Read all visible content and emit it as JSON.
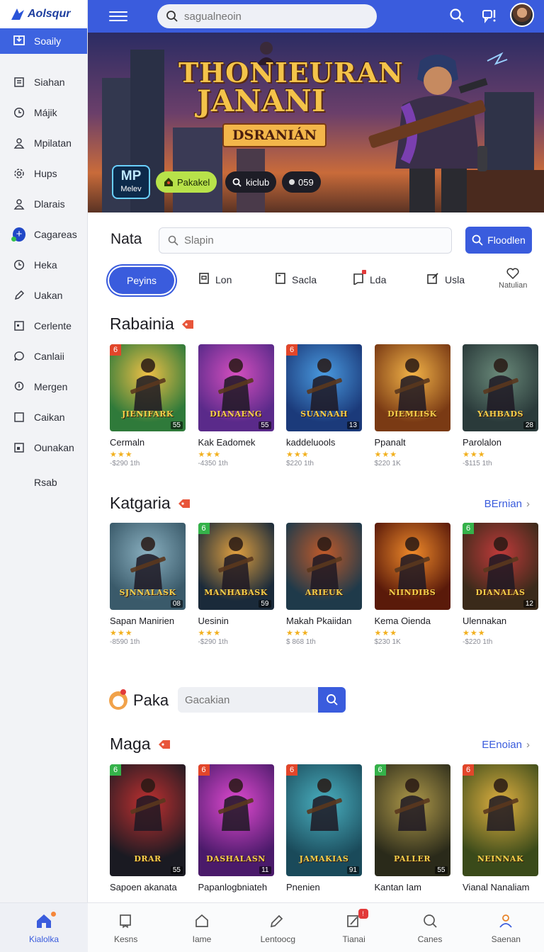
{
  "app": {
    "logo_text": "Aolsqur"
  },
  "sidebar": {
    "active": {
      "label": "Soaily"
    },
    "items": [
      {
        "label": "Siahan",
        "icon": "document-icon"
      },
      {
        "label": "Májik",
        "icon": "clock-icon"
      },
      {
        "label": "Mpilatan",
        "icon": "user-icon"
      },
      {
        "label": "Hups",
        "icon": "gear-icon"
      },
      {
        "label": "Dlarais",
        "icon": "user-icon"
      },
      {
        "label": "Cagareas",
        "icon": "category-icon"
      },
      {
        "label": "Heka",
        "icon": "clock-icon"
      },
      {
        "label": "Uakan",
        "icon": "pencil-icon"
      },
      {
        "label": "Cerlente",
        "icon": "calendar-icon"
      },
      {
        "label": "Canlaii",
        "icon": "chat-icon"
      },
      {
        "label": "Mergen",
        "icon": "location-icon"
      },
      {
        "label": "Caikan",
        "icon": "square-icon"
      },
      {
        "label": "Ounakan",
        "icon": "image-icon"
      }
    ],
    "footer_label": "Rsab"
  },
  "topbar": {
    "search_placeholder": "sagualneoin",
    "accent": "#3a5cdd"
  },
  "hero": {
    "title_line1": "THONIEURAN",
    "title_line2": "JANANI",
    "subtitle": "DSRANIÁN",
    "badge_big": "MP",
    "badge_small": "Melev",
    "pill_green": "Pakakel",
    "pill_search": "kiclub",
    "pill_count": "059"
  },
  "search_row": {
    "label": "Nata",
    "placeholder": "Slapin",
    "button": "Floodlen"
  },
  "filters": {
    "active": "Peyins",
    "items": [
      "Lon",
      "Sacla",
      "Lda",
      "Usla"
    ],
    "fav_label": "Natulian"
  },
  "sections": {
    "s1": {
      "title": "Rabainia",
      "cards": [
        {
          "name": "Cermaln",
          "meta": "-$290 1th",
          "cap": "JIENIFARK",
          "num": "55",
          "colors": [
            "#2f7a3a",
            "#f0c046"
          ],
          "corner": "6",
          "corner_color": "#e2462a"
        },
        {
          "name": "Kak Eadomek",
          "meta": "-4350 1th",
          "cap": "DIANAENG",
          "num": "55",
          "colors": [
            "#5a2a8a",
            "#d54fbf"
          ],
          "corner": "",
          "corner_color": ""
        },
        {
          "name": "kaddeluools",
          "meta": "$220 1th",
          "cap": "SUANAAH",
          "num": "13",
          "colors": [
            "#1b3a7a",
            "#4a9be0"
          ],
          "corner": "6",
          "corner_color": "#e2462a"
        },
        {
          "name": "Ppanalt",
          "meta": "$220 1K",
          "cap": "DIEMLISK",
          "num": "",
          "colors": [
            "#7a3a14",
            "#f3b448"
          ],
          "corner": "",
          "corner_color": ""
        },
        {
          "name": "Parolalon",
          "meta": "-$115 1th",
          "cap": "YAHBADS",
          "num": "28",
          "colors": [
            "#2a3a3a",
            "#6a8a7a"
          ],
          "corner": "",
          "corner_color": ""
        }
      ]
    },
    "s2": {
      "title": "Katgaria",
      "see_more": "BErnian",
      "cards": [
        {
          "name": "Sapan Manirien",
          "meta": "-8590 1th",
          "cap": "SJNNALASK",
          "num": "08",
          "colors": [
            "#3a5a6a",
            "#8ab0c0"
          ],
          "corner": "",
          "corner_color": ""
        },
        {
          "name": "Uesinin",
          "meta": "-$290 1th",
          "cap": "MANHABASK",
          "num": "59",
          "colors": [
            "#1a2a3a",
            "#e0a040"
          ],
          "corner": "6",
          "corner_color": "#35b24a"
        },
        {
          "name": "Makah Pkaiidan",
          "meta": "$ 868 1th",
          "cap": "ARIEUK",
          "num": "",
          "colors": [
            "#1f3a4a",
            "#c05a2a"
          ],
          "corner": "",
          "corner_color": ""
        },
        {
          "name": "Kema Oienda",
          "meta": "$230 1K",
          "cap": "NIINDIBS",
          "num": "",
          "colors": [
            "#5a1a0a",
            "#f08a2a"
          ],
          "corner": "",
          "corner_color": ""
        },
        {
          "name": "Ulennakan",
          "meta": "-$220 1th",
          "cap": "DIANALAS",
          "num": "12",
          "colors": [
            "#3a2a1a",
            "#c03a3a"
          ],
          "corner": "6",
          "corner_color": "#35b24a"
        }
      ]
    },
    "paka": {
      "label": "Paka",
      "placeholder": "Gacakian"
    },
    "s3": {
      "title": "Maga",
      "see_more": "EEnoian",
      "cards": [
        {
          "name": "Sapoen akanata",
          "meta": "",
          "cap": "DRAR",
          "num": "55",
          "colors": [
            "#1a1a22",
            "#c03030"
          ],
          "corner": "6",
          "corner_color": "#35b24a"
        },
        {
          "name": "Papanlogbniateh",
          "meta": "",
          "cap": "DASHALASN",
          "num": "11",
          "colors": [
            "#4a1a6a",
            "#e04ad0"
          ],
          "corner": "6",
          "corner_color": "#e2462a"
        },
        {
          "name": "Pnenien",
          "meta": "",
          "cap": "JAMAKIAS",
          "num": "91",
          "colors": [
            "#1a4a5a",
            "#4ab0c0"
          ],
          "corner": "6",
          "corner_color": "#e2462a"
        },
        {
          "name": "Kantan Iam",
          "meta": "",
          "cap": "PALLER",
          "num": "55",
          "colors": [
            "#2a2a1a",
            "#b09a4a"
          ],
          "corner": "6",
          "corner_color": "#35b24a"
        },
        {
          "name": "Vianal Nanaliam",
          "meta": "",
          "cap": "NEINNAK",
          "num": "",
          "colors": [
            "#3a4a1a",
            "#e0b040"
          ],
          "corner": "6",
          "corner_color": "#e2462a"
        }
      ]
    }
  },
  "bottom_nav": {
    "home": "Kialolka",
    "items": [
      {
        "label": "Kesns",
        "icon": "book-icon",
        "badge": ""
      },
      {
        "label": "Iame",
        "icon": "home-icon",
        "badge": ""
      },
      {
        "label": "Lentoocg",
        "icon": "edit-icon",
        "badge": ""
      },
      {
        "label": "Tianai",
        "icon": "chart-icon",
        "badge": "!"
      },
      {
        "label": "Canes",
        "icon": "search-icon",
        "badge": ""
      },
      {
        "label": "Saenan",
        "icon": "profile-icon",
        "badge": ""
      }
    ]
  }
}
